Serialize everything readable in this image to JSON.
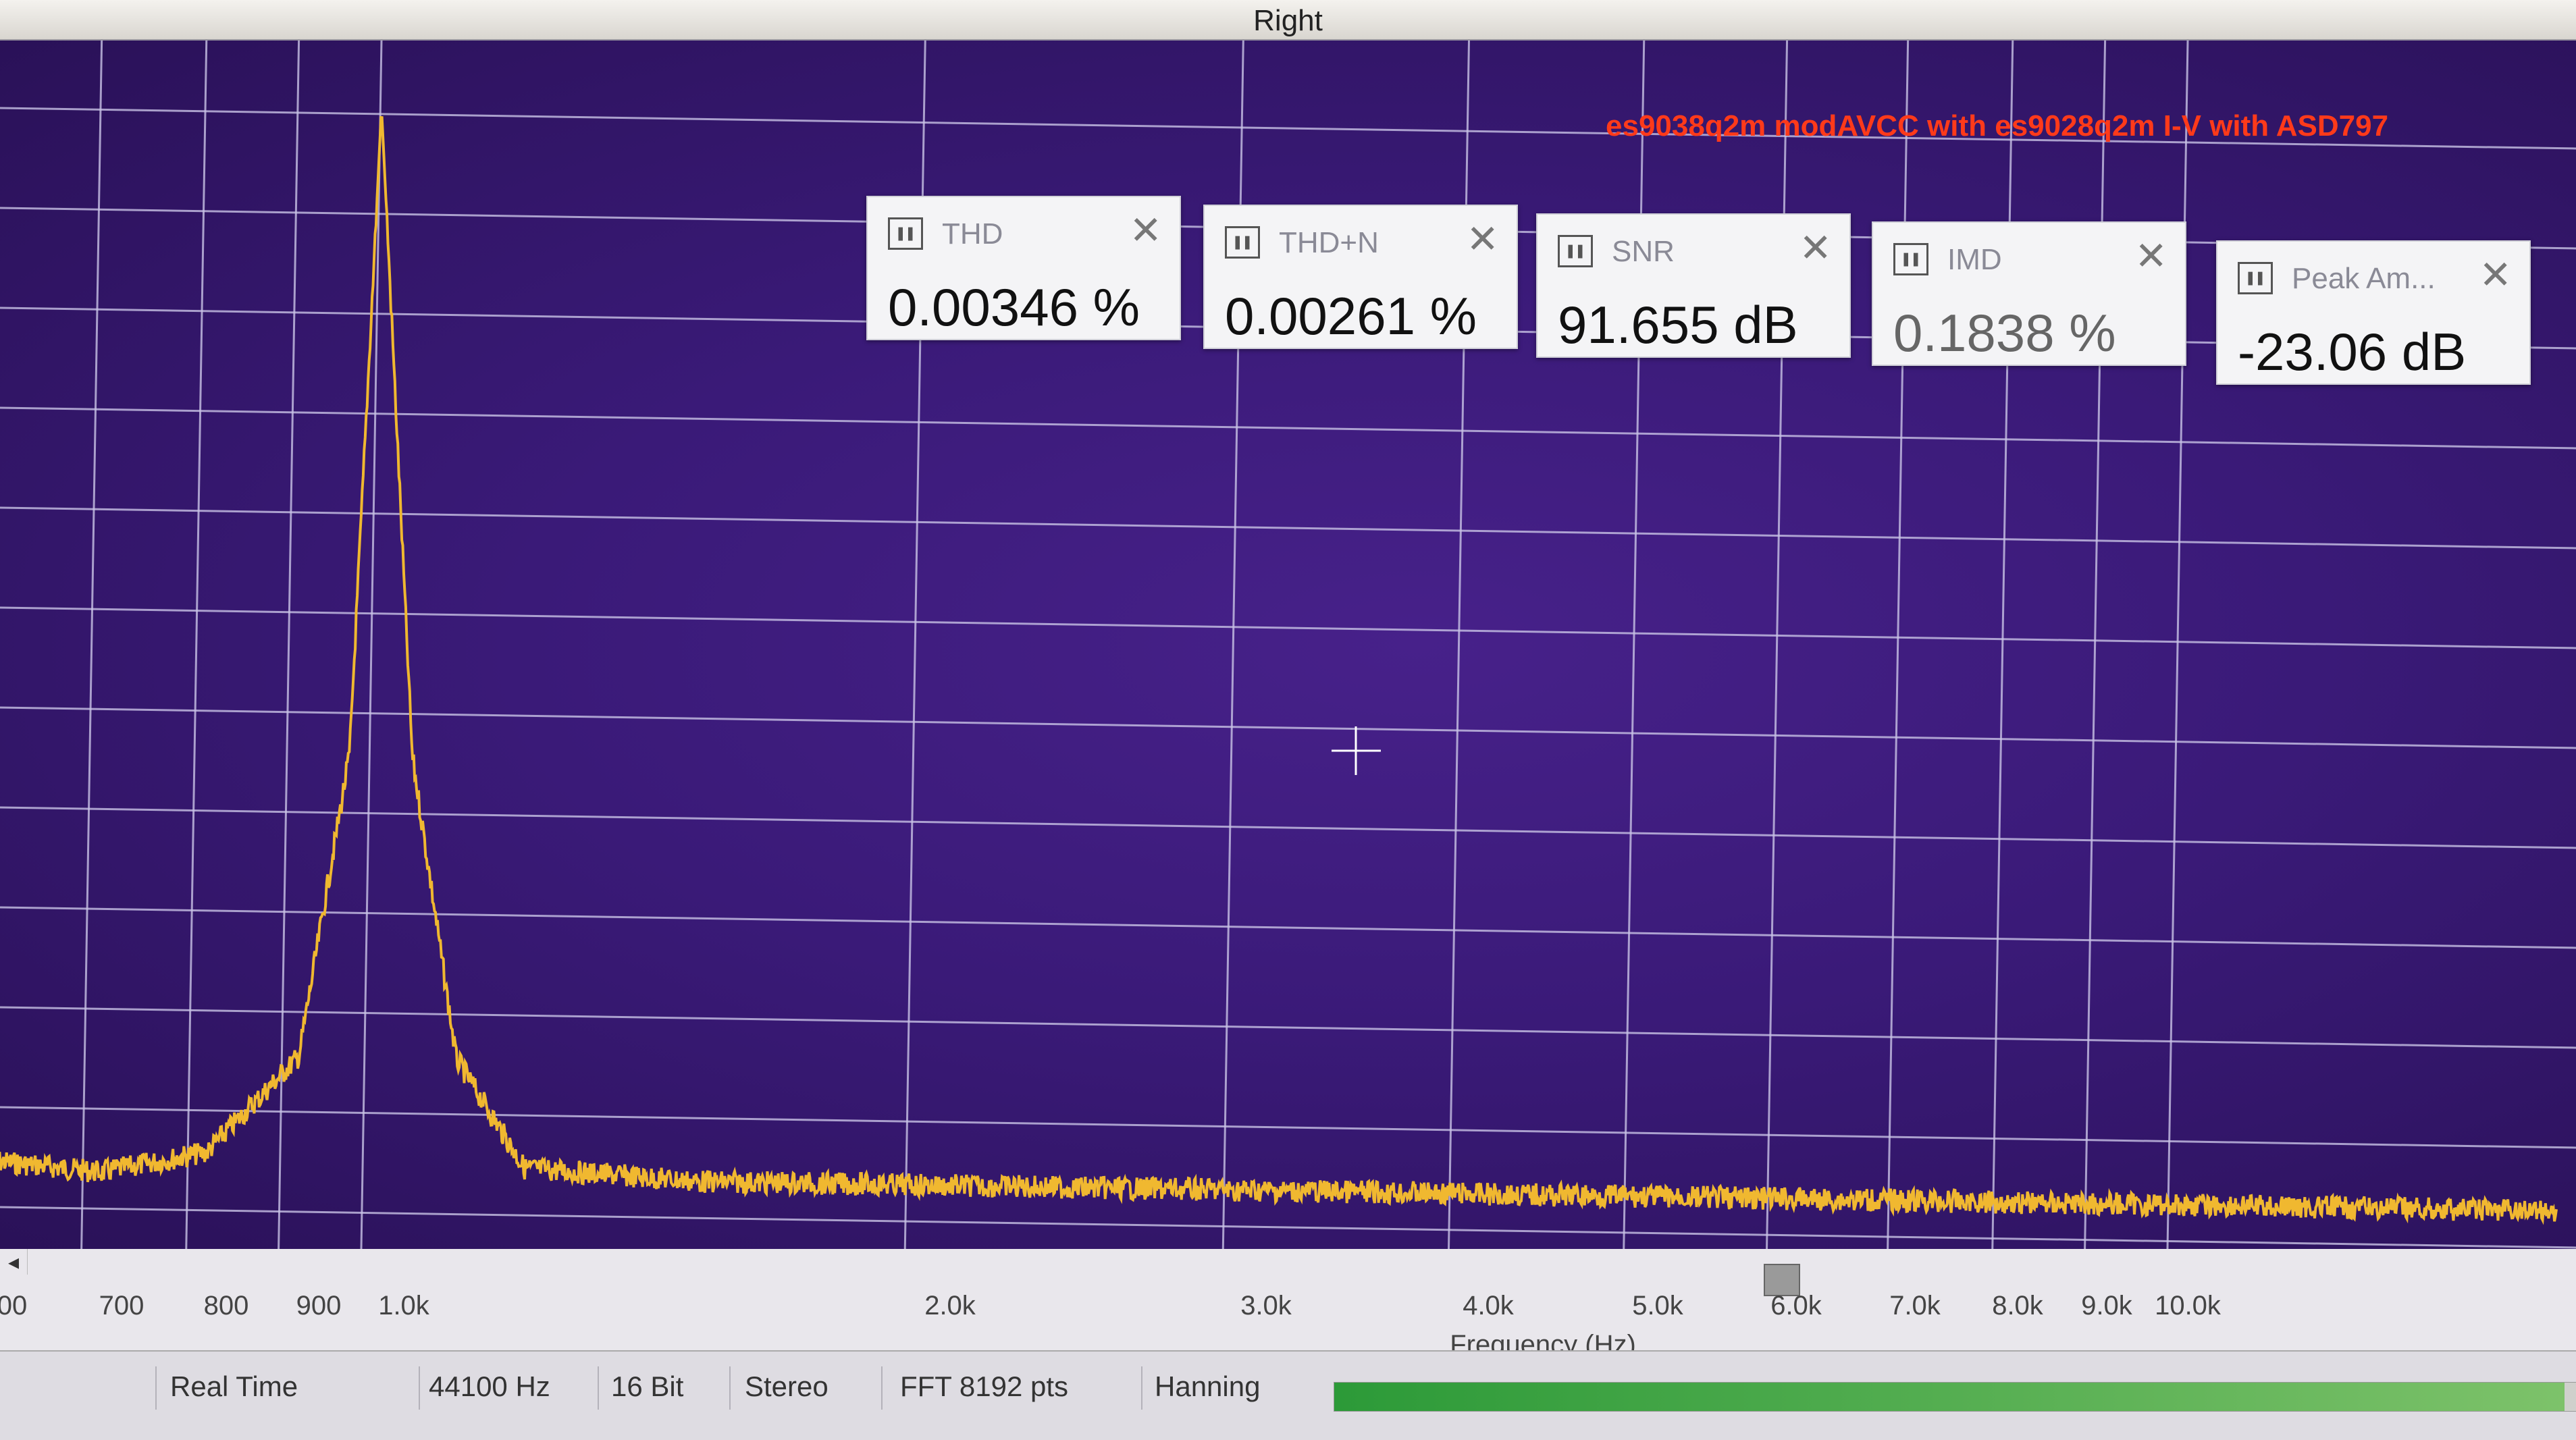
{
  "window": {
    "title": "Right"
  },
  "annotation": "es9038q2m modAVCC with es9028q2m I-V with ASD797",
  "meters": [
    {
      "label": "THD",
      "value": "0.00346 %"
    },
    {
      "label": "THD+N",
      "value": "0.00261 %"
    },
    {
      "label": "SNR",
      "value": "91.655 dB"
    },
    {
      "label": "IMD",
      "value": "0.1838 %"
    },
    {
      "label": "Peak Am...",
      "value": "-23.06 dB"
    }
  ],
  "meter_icon": "pause-icon",
  "close_icon": "close-icon",
  "chart_data": {
    "type": "line",
    "title": "",
    "xlabel": "Frequency (Hz)",
    "ylabel": "",
    "x_scale": "log",
    "xlim": [
      600,
      16000
    ],
    "tick_labels": [
      "00",
      "700",
      "800",
      "900",
      "1.0k",
      "2.0k",
      "3.0k",
      "4.0k",
      "5.0k",
      "6.0k",
      "7.0k",
      "8.0k",
      "9.0k",
      "10.0k"
    ],
    "series": [
      {
        "color": "#f0b830",
        "x": [
          600,
          700,
          800,
          900,
          960,
          990,
          1000,
          1010,
          1040,
          1100,
          1200,
          1500,
          2000,
          3000,
          4000,
          5000,
          6000,
          8000,
          10000,
          16000
        ],
        "relative_level": [
          0.02,
          0.01,
          0.03,
          0.12,
          0.4,
          0.85,
          1.0,
          0.85,
          0.4,
          0.12,
          0.02,
          0.01,
          0.01,
          0.01,
          0.01,
          0.01,
          0.01,
          0.01,
          0.01,
          0.01
        ]
      }
    ],
    "grid": true,
    "cursor": "crosshair"
  },
  "status": {
    "mode": "Real Time",
    "sample_rate": "44100 Hz",
    "bit_depth": "16 Bit",
    "channels": "Stereo",
    "fft_size": "FFT 8192 pts",
    "window": "Hanning",
    "level_fraction": 0.99
  },
  "colors": {
    "background": "#3a1a78",
    "trace": "#f0b830",
    "grid": "#c9c3e6",
    "annotation": "#ff3a1a",
    "meter_fill": "#2c9a38"
  }
}
